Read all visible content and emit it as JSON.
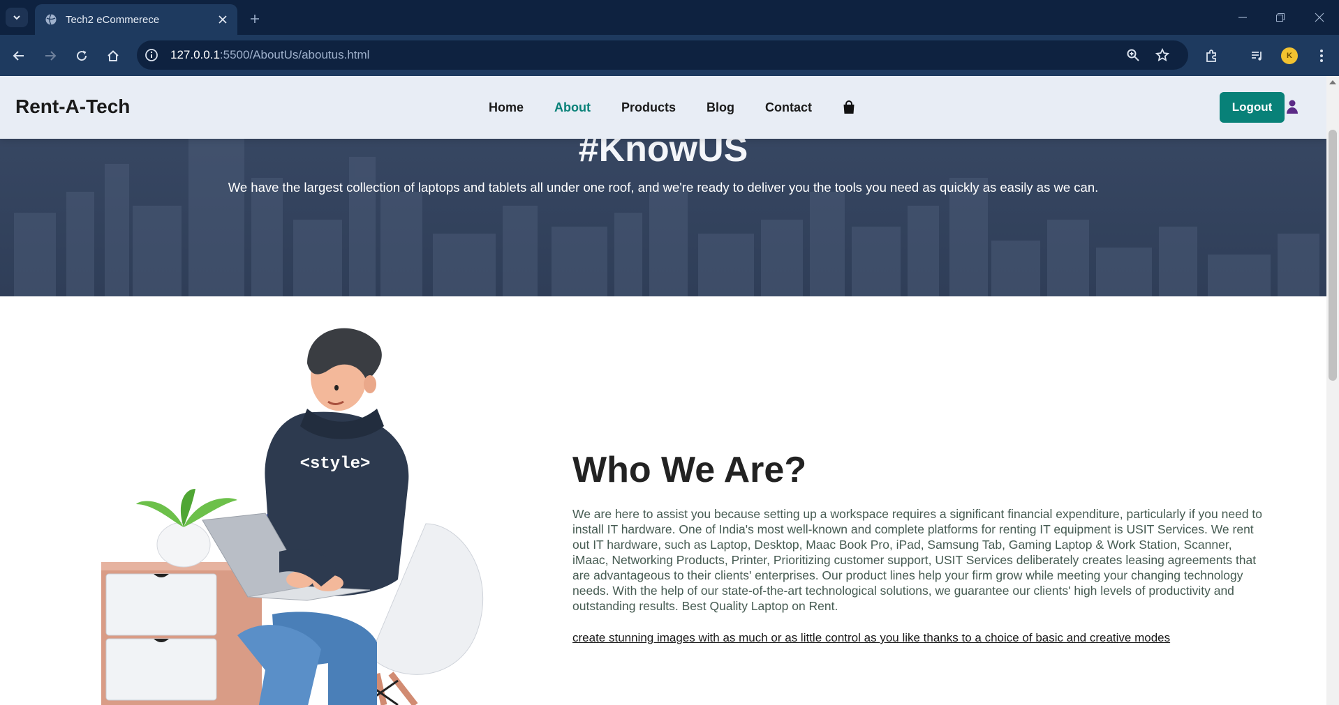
{
  "browser": {
    "tab_title": "Tech2 eCommerece",
    "url_host": "127.0.0.1",
    "url_rest": ":5500/AboutUs/aboutus.html",
    "profile_initial": "K"
  },
  "header": {
    "brand": "Rent-A-Tech",
    "nav": [
      {
        "label": "Home",
        "active": false
      },
      {
        "label": "About",
        "active": true
      },
      {
        "label": "Products",
        "active": false
      },
      {
        "label": "Blog",
        "active": false
      },
      {
        "label": "Contact",
        "active": false
      }
    ],
    "logout_label": "Logout",
    "accent": "#088178"
  },
  "hero": {
    "heading": "#KnowUS",
    "text": "We have the largest collection of laptops and tablets all under one roof, and we're ready to deliver you the tools you need as quickly as easily as we can."
  },
  "about": {
    "illustration_label": "<style>",
    "title": "Who We Are?",
    "body": "We are here to assist you because setting up a workspace requires a significant financial expenditure, particularly if you need to install IT hardware. One of India's most well-known and complete platforms for renting IT equipment is USIT Services. We rent out IT hardware, such as Laptop, Desktop, Maac Book Pro, iPad, Samsung Tab, Gaming Laptop & Work Station, Scanner, iMaac, Networking Products, Printer, Prioritizing customer support, USIT Services deliberately creates leasing agreements that are advantageous to their clients' enterprises. Our product lines help your firm grow while meeting your changing technology needs. With the help of our state-of-the-art technological solutions, we guarantee our clients' high levels of productivity and outstanding results. Best Quality Laptop on Rent.",
    "marquee": "create stunning images with as much or as little control as you like thanks to a choice of basic and creative modes"
  }
}
